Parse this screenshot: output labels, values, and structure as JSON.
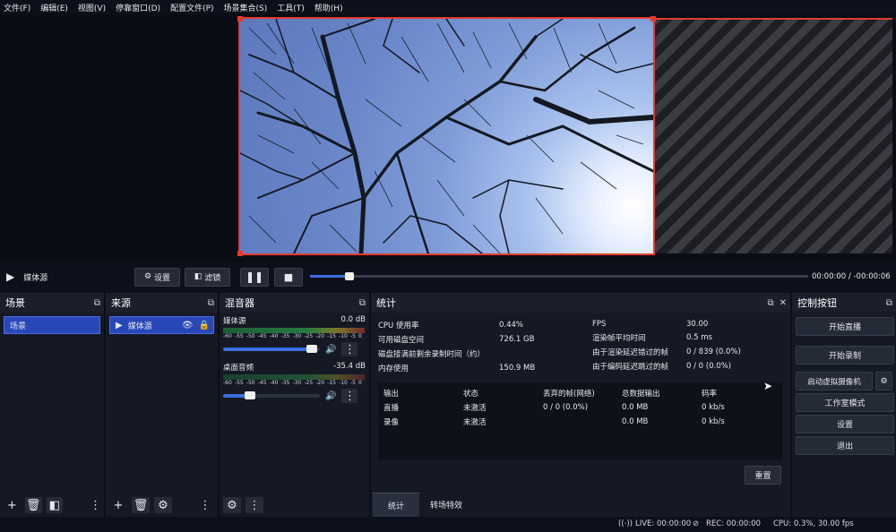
{
  "menu": [
    "文件(F)",
    "编辑(E)",
    "视图(V)",
    "停靠窗口(D)",
    "配置文件(P)",
    "场景集合(S)",
    "工具(T)",
    "帮助(H)"
  ],
  "mediabar": {
    "source_name": "媒体源",
    "settings_label": "设置",
    "filters_label": "滤镜",
    "time_current": "00:00:00",
    "time_separator": "/",
    "time_remaining": "-00:00:06",
    "progress": 0.08
  },
  "scenes": {
    "title": "场景",
    "items": [
      "场景"
    ]
  },
  "sources": {
    "title": "来源",
    "items": [
      "媒体源"
    ]
  },
  "mixer": {
    "title": "混音器",
    "ticks": [
      "-60",
      "-55",
      "-50",
      "-45",
      "-40",
      "-35",
      "-30",
      "-25",
      "-20",
      "-15",
      "-10",
      "-5",
      "0"
    ],
    "channels": [
      {
        "name": "媒体源",
        "db": "0.0 dB",
        "volume": 0.92
      },
      {
        "name": "桌面音频",
        "db": "-35.4 dB",
        "volume": 0.28
      }
    ]
  },
  "stats": {
    "title": "统计",
    "left": [
      {
        "label": "CPU 使用率",
        "value": "0.44%"
      },
      {
        "label": "可用磁盘空间",
        "value": "726.1 GB"
      },
      {
        "label": "磁盘接满前剩余录制时间（约）",
        "value": ""
      },
      {
        "label": "内存使用",
        "value": "150.9 MB"
      }
    ],
    "right": [
      {
        "label": "FPS",
        "value": "30.00"
      },
      {
        "label": "渲染帧平均时间",
        "value": "0.5 ms"
      },
      {
        "label": "由于渲染延迟错过的帧",
        "value": "0 / 839 (0.0%)"
      },
      {
        "label": "由于编码延迟跳过的帧",
        "value": "0 / 0 (0.0%)"
      }
    ],
    "table": {
      "headers": [
        "输出",
        "状态",
        "丢弃的帧(网络)",
        "总数据输出",
        "码率"
      ],
      "rows": [
        [
          "直播",
          "未激活",
          "0 / 0 (0.0%)",
          "0.0 MB",
          "0 kb/s"
        ],
        [
          "录像",
          "未激活",
          "",
          "0.0 MB",
          "0 kb/s"
        ]
      ]
    },
    "reset_label": "重置",
    "tabs": [
      "统计",
      "转场特效"
    ]
  },
  "controls": {
    "title": "控制按钮",
    "start_stream": "开始直播",
    "start_record": "开始录制",
    "start_virtual_cam": "启动虚拟摄像机",
    "studio_mode": "工作室模式",
    "settings": "设置",
    "exit": "退出"
  },
  "statusbar": {
    "live": "LIVE: 00:00:00",
    "rec": "REC: 00:00:00",
    "cpu": "CPU: 0.3%, 30.00 fps"
  },
  "colors": {
    "accent": "#2948b8",
    "selection_border": "#e53a2c",
    "panel": "#151924"
  }
}
